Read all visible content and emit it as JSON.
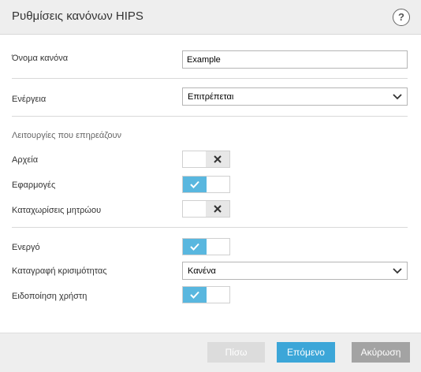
{
  "dialog": {
    "title": "Ρυθμίσεις κανόνων HIPS",
    "help_symbol": "?"
  },
  "form": {
    "rule_name_label": "Όνομα κανόνα",
    "rule_name_value": "Example",
    "action_label": "Ενέργεια",
    "action_value": "Επιτρέπεται",
    "affected_ops_title": "Λειτουργίες που επηρεάζουν",
    "files_label": "Αρχεία",
    "files_on": false,
    "apps_label": "Εφαρμογές",
    "apps_on": true,
    "registry_label": "Καταχωρίσεις μητρώου",
    "registry_on": false,
    "enabled_label": "Ενεργό",
    "enabled_on": true,
    "log_severity_label": "Καταγραφή κρισιμότητας",
    "log_severity_value": "Κανένα",
    "notify_user_label": "Ειδοποίηση χρήστη",
    "notify_user_on": true
  },
  "footer": {
    "back_label": "Πίσω",
    "next_label": "Επόμενο",
    "cancel_label": "Ακύρωση"
  },
  "colors": {
    "toggle_on": "#59b7df",
    "primary_button": "#3ca6d8",
    "header_bg": "#eeeeee"
  },
  "icons": {
    "help": "question-mark-icon",
    "dropdown": "chevron-down-icon",
    "toggle_on": "check-icon",
    "toggle_off": "x-icon"
  }
}
